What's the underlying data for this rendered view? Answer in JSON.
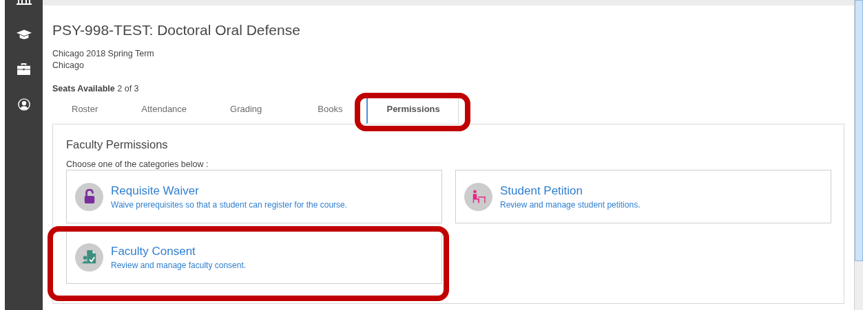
{
  "course": {
    "title": "PSY-998-TEST: Doctoral Oral Defense",
    "term": "Chicago 2018 Spring Term",
    "campus": "Chicago",
    "seats_label": "Seats Available",
    "seats_value": "2 of 3"
  },
  "tabs": [
    {
      "label": "Roster",
      "selected": false,
      "highlighted": false
    },
    {
      "label": "Attendance",
      "selected": false,
      "highlighted": false
    },
    {
      "label": "Grading",
      "selected": false,
      "highlighted": false
    },
    {
      "label": "Books",
      "selected": false,
      "highlighted": false
    },
    {
      "label": "Permissions",
      "selected": true,
      "highlighted": true
    }
  ],
  "panel": {
    "heading": "Faculty Permissions",
    "instruction": "Choose one of the categories below :",
    "cards": [
      {
        "title": "Requisite Waiver",
        "description": "Waive prerequisites so that a student can register for the course.",
        "highlighted": false
      },
      {
        "title": "Student Petition",
        "description": "Review and manage student petitions.",
        "highlighted": false
      },
      {
        "title": "Faculty Consent",
        "description": "Review and manage faculty consent.",
        "highlighted": true
      }
    ]
  }
}
